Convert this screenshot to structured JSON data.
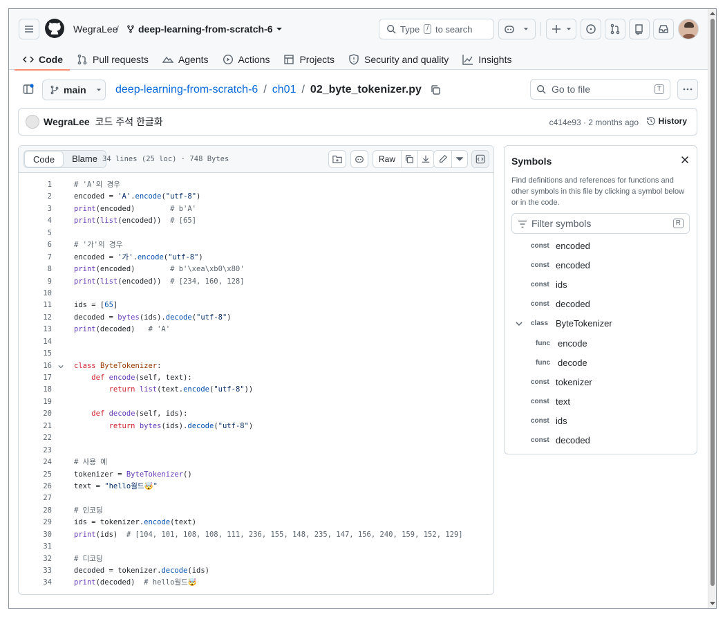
{
  "header": {
    "owner": "WegraLee",
    "separator": "/",
    "repo": "deep-learning-from-scratch-6",
    "search_prefix": "Type",
    "search_key": "/",
    "search_suffix": "to search"
  },
  "tabs": [
    {
      "label": "Code"
    },
    {
      "label": "Pull requests"
    },
    {
      "label": "Agents"
    },
    {
      "label": "Actions"
    },
    {
      "label": "Projects"
    },
    {
      "label": "Security and quality"
    },
    {
      "label": "Insights"
    }
  ],
  "breadcrumb": {
    "branch": "main",
    "repo": "deep-learning-from-scratch-6",
    "sep": "/",
    "folder": "ch01",
    "file": "02_byte_tokenizer.py",
    "goto_placeholder": "Go to file",
    "goto_key": "T"
  },
  "commit": {
    "author": "WegraLee",
    "message": "코드 주석 한글화",
    "meta": "c414e93 · 2 months ago",
    "history": "History"
  },
  "code_header": {
    "code_tab": "Code",
    "blame_tab": "Blame",
    "info": "34 lines (25 loc) · 748 Bytes",
    "raw": "Raw"
  },
  "code_lines": [
    "1",
    "2",
    "3",
    "4",
    "5",
    "6",
    "7",
    "8",
    "9",
    "10",
    "11",
    "12",
    "13",
    "14",
    "15",
    "16",
    "17",
    "18",
    "19",
    "20",
    "21",
    "22",
    "23",
    "24",
    "25",
    "26",
    "27",
    "28",
    "29",
    "30",
    "31",
    "32",
    "33",
    "34"
  ],
  "symbols": {
    "title": "Symbols",
    "description": "Find definitions and references for functions and other symbols in this file by clicking a symbol below or in the code.",
    "filter_placeholder": "Filter symbols",
    "filter_key": "R",
    "items": [
      {
        "type": "const",
        "name": "encoded"
      },
      {
        "type": "const",
        "name": "encoded"
      },
      {
        "type": "const",
        "name": "ids"
      },
      {
        "type": "const",
        "name": "decoded"
      },
      {
        "type": "class",
        "name": "ByteTokenizer"
      },
      {
        "type": "func",
        "name": "encode"
      },
      {
        "type": "func",
        "name": "decode"
      },
      {
        "type": "const",
        "name": "tokenizer"
      },
      {
        "type": "const",
        "name": "text"
      },
      {
        "type": "const",
        "name": "ids"
      },
      {
        "type": "const",
        "name": "decoded"
      }
    ]
  },
  "colors": {
    "accent": "#fd8c73",
    "link": "#0969da",
    "keyword": "#cf222e",
    "function": "#6639ba",
    "string": "#0a3069"
  }
}
